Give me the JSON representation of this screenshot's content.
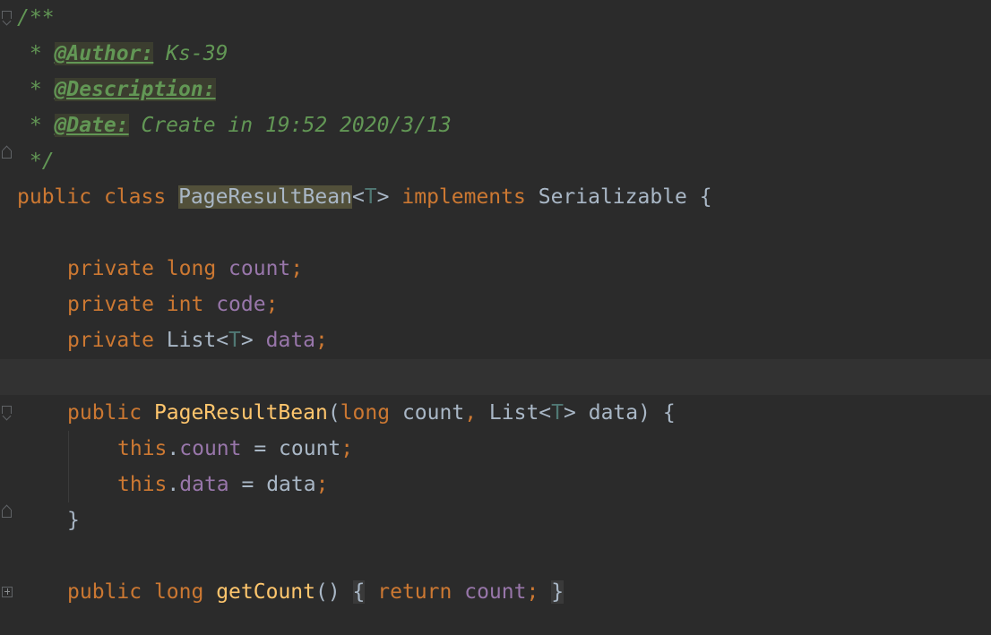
{
  "editor": {
    "language": "java",
    "colors": {
      "background": "#2b2b2b",
      "current_line": "#323232",
      "comment": "#629755",
      "keyword": "#cc7832",
      "field": "#9876aa",
      "method": "#ffc66d",
      "type_param": "#507874",
      "text": "#a9b7c6",
      "highlight": "#52503a"
    },
    "current_line_index": 10
  },
  "doc": {
    "open": "/**",
    "star": " * ",
    "author_tag": "@Author:",
    "author_value": " Ks-39",
    "description_tag": "@Description:",
    "date_tag": "@Date:",
    "date_value": " Create in 19:52 2020/3/13",
    "close": " */"
  },
  "class_decl": {
    "kw_public": "public",
    "kw_class": "class",
    "class_name": "PageResultBean",
    "lt": "<",
    "type_param": "T",
    "gt": ">",
    "kw_implements": "implements",
    "interface": "Serializable",
    "brace": "{"
  },
  "fields": [
    {
      "mod": "private",
      "type": "long",
      "name": "count",
      "semi": ";"
    },
    {
      "mod": "private",
      "type": "int",
      "name": "code",
      "semi": ";"
    },
    {
      "mod": "private",
      "type_base": "List",
      "type_param": "T",
      "name": "data",
      "semi": ";"
    }
  ],
  "constructor": {
    "kw_public": "public",
    "name": "PageResultBean",
    "open_paren": "(",
    "p1_type": "long",
    "p1_name": "count",
    "comma": ",",
    "p2_type": "List",
    "p2_tp": "T",
    "p2_name": "data",
    "close_paren": ")",
    "brace": "{",
    "body": [
      {
        "this": "this",
        "dot": ".",
        "field": "count",
        "assign": " = ",
        "value": "count",
        "semi": ";"
      },
      {
        "this": "this",
        "dot": ".",
        "field": "data",
        "assign": " = ",
        "value": "data",
        "semi": ";"
      }
    ],
    "close_brace": "}"
  },
  "getter": {
    "kw_public": "public",
    "type": "long",
    "name": "getCount",
    "parens": "()",
    "fold_open": "{",
    "kw_return": "return",
    "field": "count",
    "semi": ";",
    "fold_close": "}"
  }
}
